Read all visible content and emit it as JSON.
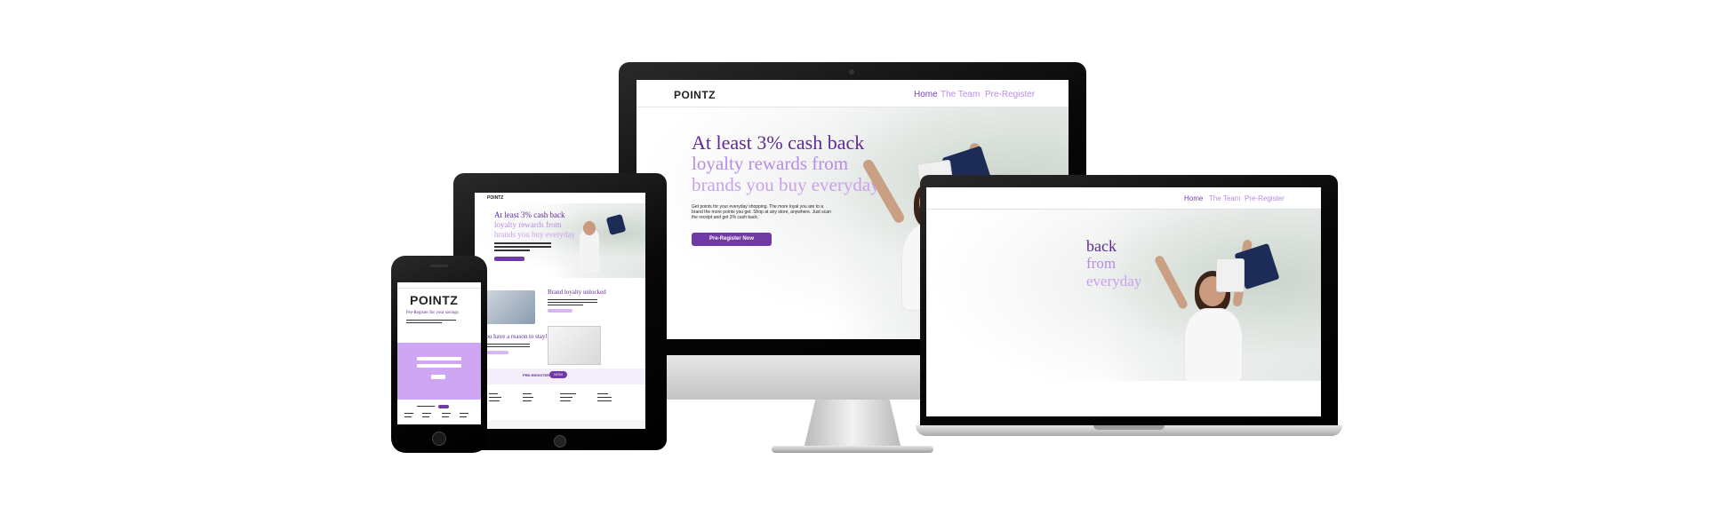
{
  "brand": {
    "logo_text": "POINTZ",
    "purple": "#6f3aa5",
    "lavender": "#b98be6",
    "light_lavender": "#d8b6f2"
  },
  "desktop": {
    "nav": {
      "home": "Home",
      "team": "The Team",
      "preregister": "Pre-Register"
    },
    "hero": {
      "headline1": "At least 3% cash back",
      "headline2": "loyalty rewards from",
      "headline3": "brands you buy everyday",
      "body1": "Get points for your everyday shopping. The more loyal you are to a",
      "body2": "brand the more points you get. Shop at any store, anywhere. Just scan",
      "body3": "the receipt and get 3% cash back.",
      "cta": "Pre-Register Now"
    }
  },
  "laptop": {
    "nav": {
      "home": "Home",
      "team": "The Team",
      "preregister": "Pre-Register"
    },
    "hero": {
      "headline1": "back",
      "headline2": "from",
      "headline3": "everyday"
    }
  },
  "tablet": {
    "hero": {
      "headline1": "At least 3% cash back",
      "headline2": "loyalty rewards from",
      "headline3": "brands you buy everyday"
    },
    "section1": "Brand loyalty unlocked",
    "section2": "You have a reason to stay!",
    "footer_cta": "PRE-REGISTER",
    "footer_btn": "NOW"
  },
  "phone": {
    "logo_text": "POINTZ",
    "headline": "Pre-Register for your savings"
  }
}
